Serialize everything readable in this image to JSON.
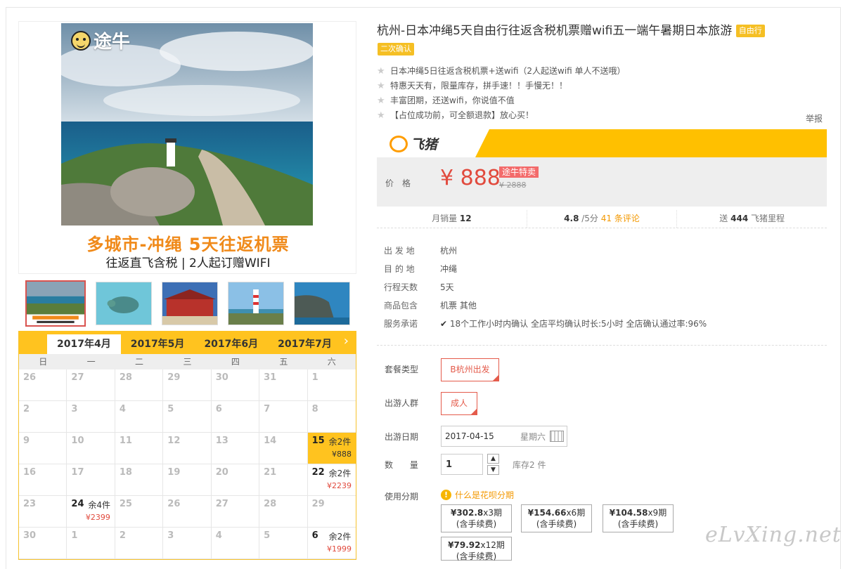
{
  "hero": {
    "logo_text": "途牛",
    "headline": "多城市-冲绳  5天往返机票",
    "subline": "往返直飞含税  |  2人起订赠WIFI"
  },
  "calendar": {
    "months": [
      "2017年4月",
      "2017年5月",
      "2017年6月",
      "2017年7月"
    ],
    "next_icon": "chevron-right-icon",
    "weekdays": [
      "日",
      "一",
      "二",
      "三",
      "四",
      "五",
      "六"
    ],
    "rows": [
      [
        {
          "d": "26"
        },
        {
          "d": "27"
        },
        {
          "d": "28"
        },
        {
          "d": "29"
        },
        {
          "d": "30"
        },
        {
          "d": "31"
        },
        {
          "d": "1"
        }
      ],
      [
        {
          "d": "2"
        },
        {
          "d": "3"
        },
        {
          "d": "4"
        },
        {
          "d": "5"
        },
        {
          "d": "6"
        },
        {
          "d": "7"
        },
        {
          "d": "8"
        }
      ],
      [
        {
          "d": "9"
        },
        {
          "d": "10"
        },
        {
          "d": "11"
        },
        {
          "d": "12"
        },
        {
          "d": "13"
        },
        {
          "d": "14"
        },
        {
          "d": "15",
          "left": "余2件",
          "price": "¥888",
          "hl": true
        }
      ],
      [
        {
          "d": "16"
        },
        {
          "d": "17"
        },
        {
          "d": "18"
        },
        {
          "d": "19"
        },
        {
          "d": "20"
        },
        {
          "d": "21"
        },
        {
          "d": "22",
          "left": "余2件",
          "price": "¥2239"
        }
      ],
      [
        {
          "d": "23"
        },
        {
          "d": "24",
          "left": "余4件",
          "price": "¥2399"
        },
        {
          "d": "25"
        },
        {
          "d": "26"
        },
        {
          "d": "27"
        },
        {
          "d": "28"
        },
        {
          "d": "29"
        }
      ],
      [
        {
          "d": "30"
        },
        {
          "d": "1"
        },
        {
          "d": "2"
        },
        {
          "d": "3"
        },
        {
          "d": "4"
        },
        {
          "d": "5"
        },
        {
          "d": "6",
          "left": "余2件",
          "price": "¥1999"
        }
      ]
    ]
  },
  "product": {
    "title": "杭州-日本冲绳5天自由行往返含税机票赠wifi五一端午暑期日本旅游",
    "tag_type": "自由行",
    "tag_confirm": "二次确认",
    "features": [
      "日本冲绳5日往返含税机票+送wifi（2人起送wifi 单人不送哦）",
      "特惠天天有，限量库存，拼手速！！手慢无！！",
      "丰富团期，还送wifi，你说值不值",
      "【占位成功前，可全额退款】放心买！"
    ],
    "report": "举报"
  },
  "price": {
    "brand": "飞猪",
    "label": "价格",
    "current": "¥ 888",
    "sale_tag": "途牛特卖",
    "original": "¥ 2888",
    "brand_color": "#ffc000",
    "price_color": "#e14a3d"
  },
  "stats": {
    "sales_label": "月销量",
    "sales": "12",
    "rating": "4.8",
    "rating_suffix": "/5分",
    "reviews": "41 条评论",
    "miles_prefix": "送",
    "miles": "444",
    "miles_suffix": "飞猪里程"
  },
  "info": [
    {
      "k": "出 发 地",
      "v": "杭州"
    },
    {
      "k": "目 的 地",
      "v": "冲绳"
    },
    {
      "k": "行程天数",
      "v": "5天"
    },
    {
      "k": "商品包含",
      "v": "机票  其他"
    },
    {
      "k": "服务承诺",
      "v": "18个工作小时内确认    全店平均确认时长:5小时    全店确认通过率:96%"
    }
  ],
  "options": {
    "package_label": "套餐类型",
    "package_value": "B杭州出发",
    "traveler_label": "出游人群",
    "traveler_value": "成人",
    "date_label": "出游日期",
    "date_value": "2017-04-15",
    "date_weekday": "星期六",
    "qty_label": "数 量",
    "qty_value": "1",
    "stock": "库存2 件",
    "installment_label": "使用分期",
    "huabei_link": "什么是花呗分期",
    "installments": [
      {
        "amount": "¥302.8",
        "period": "x3期",
        "fee": "(含手续费)"
      },
      {
        "amount": "¥154.66",
        "period": "x6期",
        "fee": "(含手续费)"
      },
      {
        "amount": "¥104.58",
        "period": "x9期",
        "fee": "(含手续费)"
      },
      {
        "amount": "¥79.92",
        "period": "x12期",
        "fee": "(含手续费)"
      }
    ]
  },
  "watermark": "eLvXing.net"
}
